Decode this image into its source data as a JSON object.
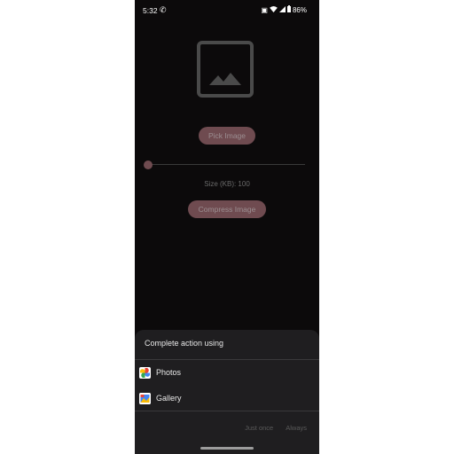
{
  "status_bar": {
    "time": "5:32",
    "battery": "86%",
    "icons": [
      "phone-call-icon",
      "nfc-icon",
      "wifi-icon",
      "signal-icon",
      "battery-icon"
    ]
  },
  "main": {
    "pick_button_label": "Pick Image",
    "size_label": "Size (KB): 100",
    "compress_button_label": "Compress Image",
    "slider_value_kb": 100
  },
  "chooser": {
    "title": "Complete action using",
    "apps": [
      {
        "label": "Photos",
        "icon": "google-photos-icon"
      },
      {
        "label": "Gallery",
        "icon": "gallery-icon"
      }
    ],
    "just_once_label": "Just once",
    "always_label": "Always"
  },
  "colors": {
    "background": "#0c0a0b",
    "accent": "#6f4b50",
    "sheet": "#1f1e20"
  }
}
